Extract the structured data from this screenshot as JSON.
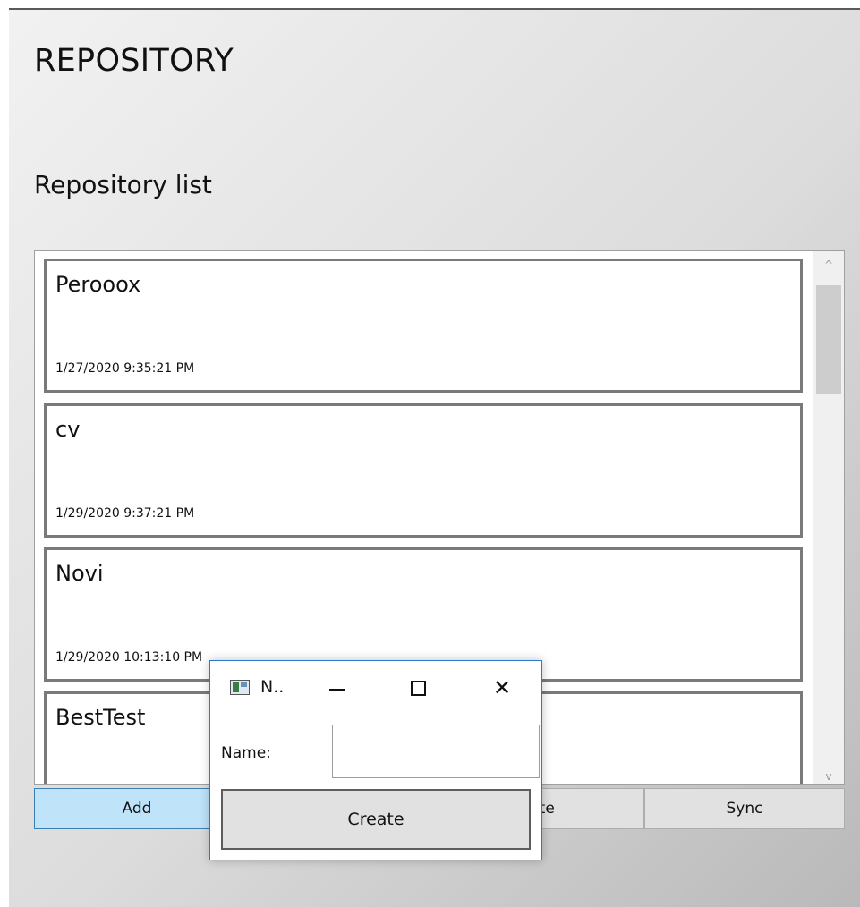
{
  "page": {
    "title": "REPOSITORY",
    "section_title": "Repository list"
  },
  "repositories": [
    {
      "name": "Perooox",
      "date": "1/27/2020 9:35:21 PM"
    },
    {
      "name": "cv",
      "date": "1/29/2020 9:37:21 PM"
    },
    {
      "name": "Novi",
      "date": "1/29/2020 10:13:10 PM"
    },
    {
      "name": "BestTest",
      "date": ""
    }
  ],
  "scrollbar": {
    "up_arrow": "^",
    "down_arrow": "v"
  },
  "buttons": {
    "add": "Add",
    "delete_visible": "ete",
    "sync": "Sync"
  },
  "dialog": {
    "title": "N..",
    "minimize_icon": "minimize-icon",
    "maximize_icon": "maximize-icon",
    "close_glyph": "✕",
    "name_label": "Name:",
    "name_value": "",
    "create_label": "Create"
  },
  "colors": {
    "add_button_bg": "#bfe3f8",
    "dialog_border": "#2b79d0"
  }
}
